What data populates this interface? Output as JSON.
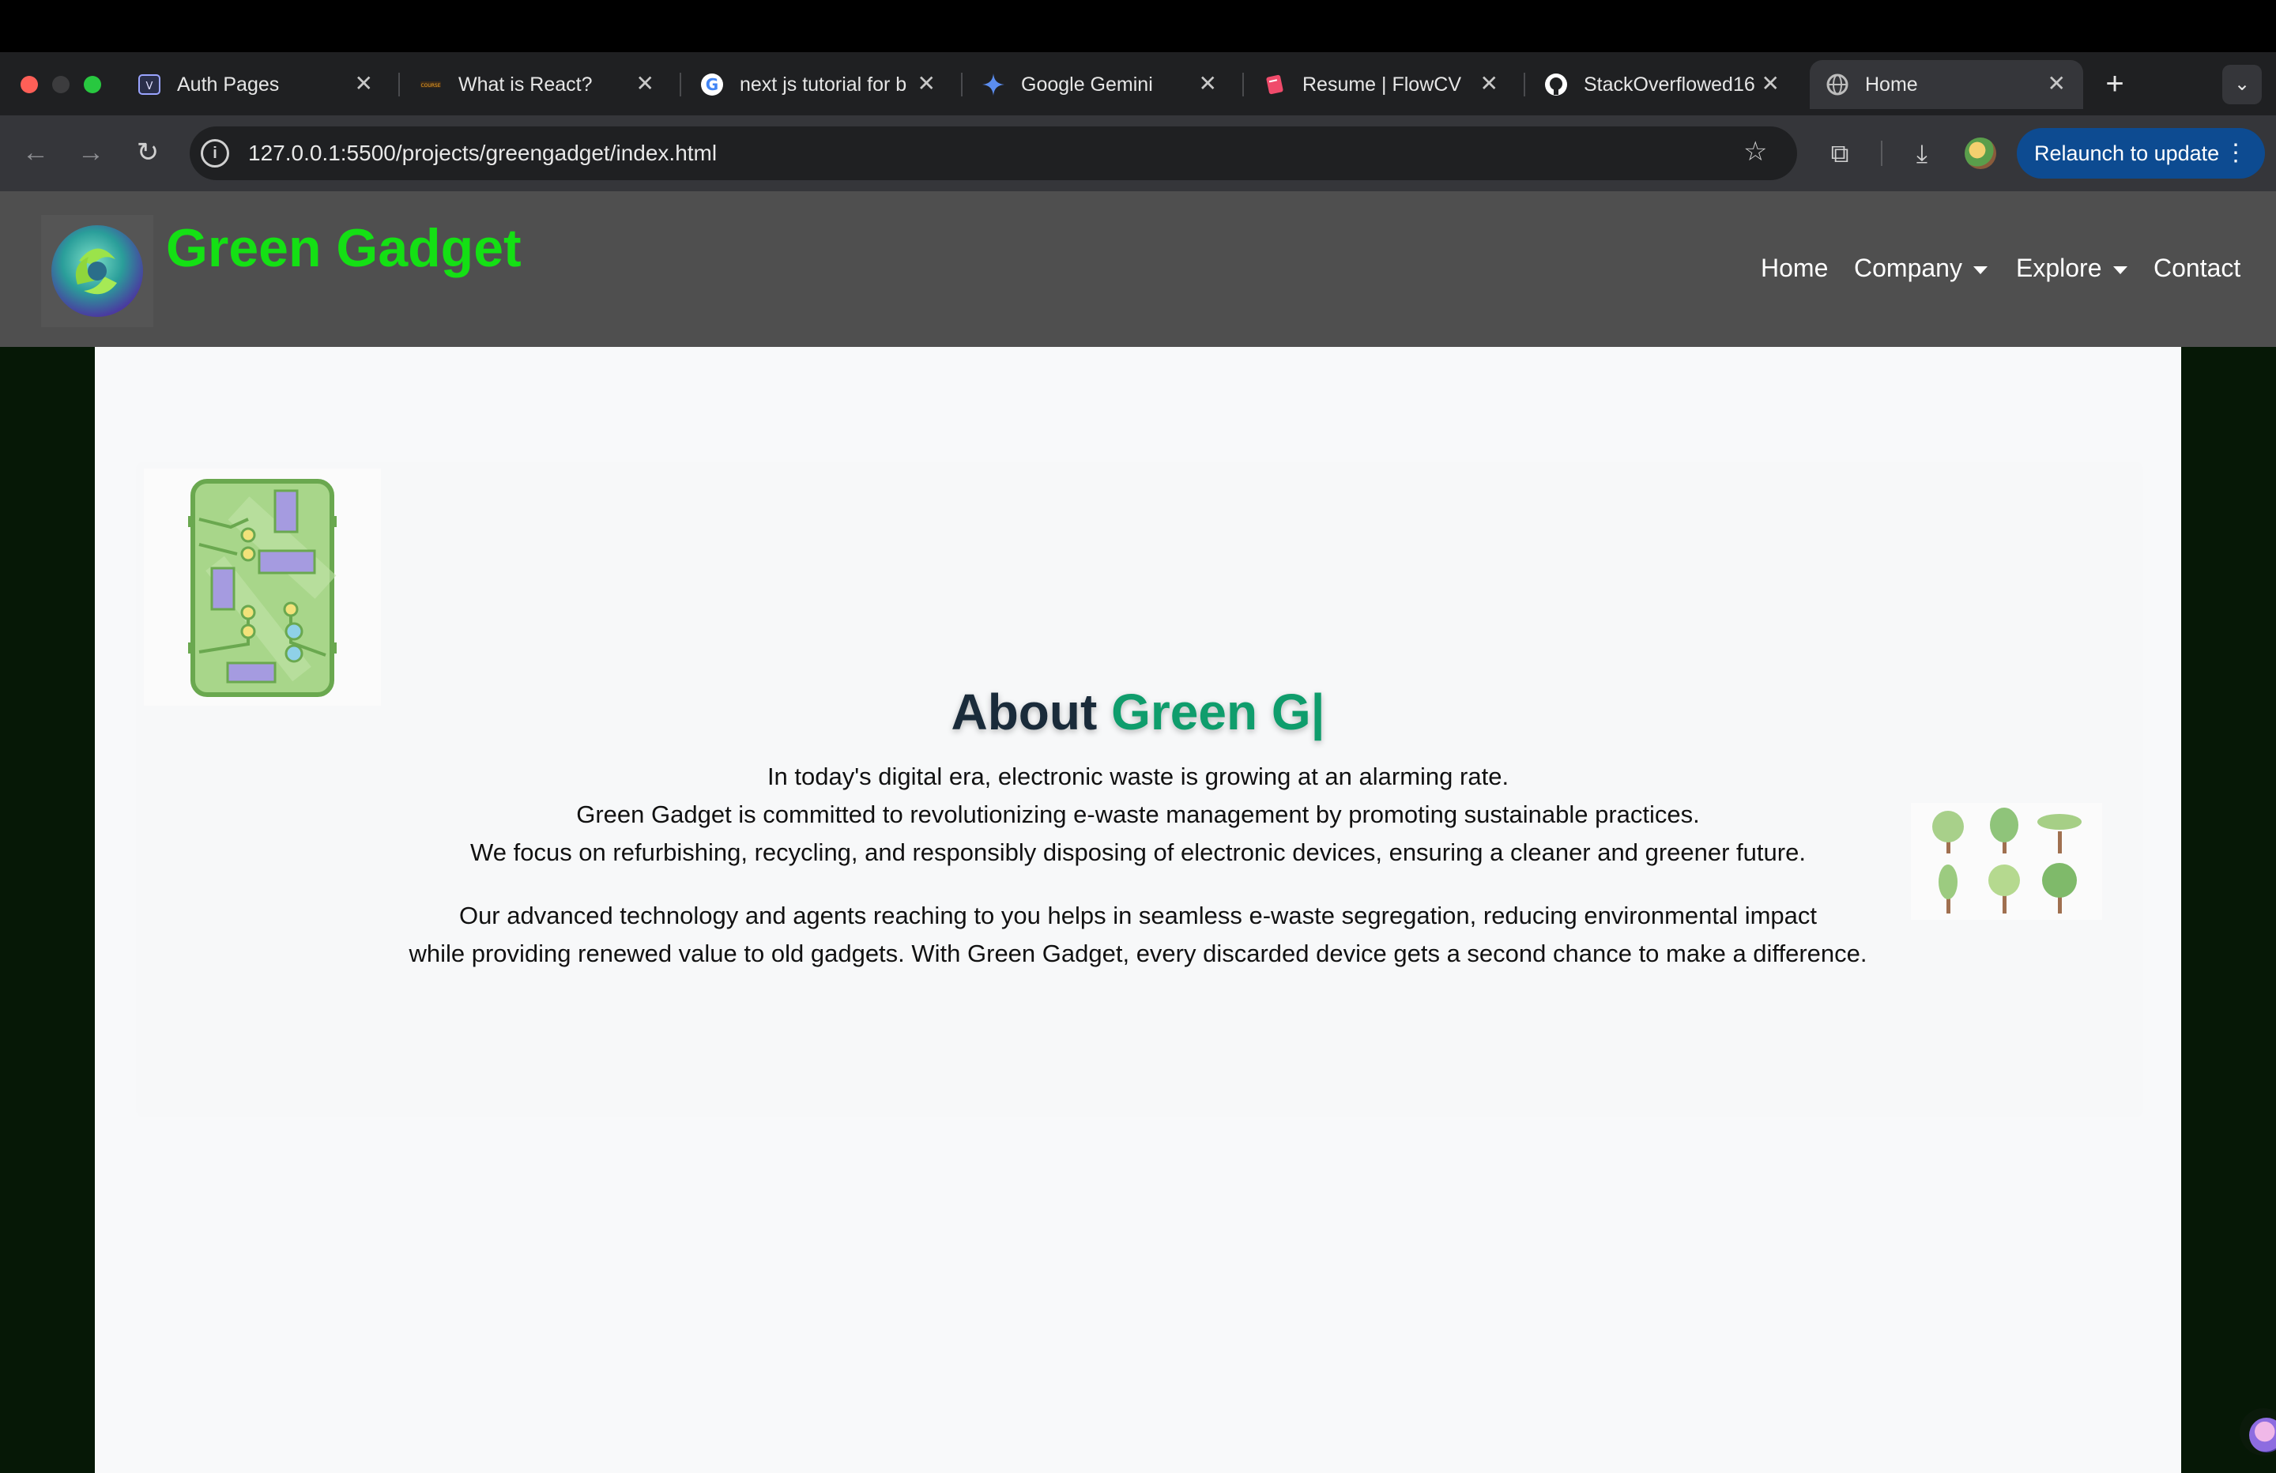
{
  "browser": {
    "tabs": [
      {
        "title": "Auth Pages",
        "icon": "vite-icon"
      },
      {
        "title": "What is React?",
        "icon": "coursera-icon"
      },
      {
        "title": "next js tutorial for b",
        "icon": "google-icon"
      },
      {
        "title": "Google Gemini",
        "icon": "gemini-icon"
      },
      {
        "title": "Resume | FlowCV",
        "icon": "flowcv-icon"
      },
      {
        "title": "StackOverflowed16",
        "icon": "github-icon"
      },
      {
        "title": "Home",
        "icon": "globe-icon"
      }
    ],
    "active_tab_index": 6,
    "url": "127.0.0.1:5500/projects/greengadget/index.html",
    "relaunch_label": "Relaunch to update"
  },
  "site": {
    "brand": "Green Gadget",
    "nav": {
      "home": "Home",
      "company": "Company",
      "explore": "Explore",
      "contact": "Contact"
    },
    "colors": {
      "brand_green": "#14e014",
      "accent_teal": "#0f9d6c",
      "navbar_bg": "#4f4f4f"
    }
  },
  "about": {
    "title_prefix": "About ",
    "title_accent": "Green G|",
    "lines": [
      "In today's digital era, electronic waste is growing at an alarming rate.",
      "Green Gadget is committed to revolutionizing e-waste management by promoting sustainable practices.",
      "We focus on refurbishing, recycling, and responsibly disposing of electronic devices, ensuring a cleaner and greener future.",
      "Our advanced technology and agents reaching to you helps in seamless e-waste segregation, reducing environmental impact",
      "while providing renewed value to old gadgets. With Green Gadget, every discarded device gets a second chance to make a difference."
    ]
  }
}
